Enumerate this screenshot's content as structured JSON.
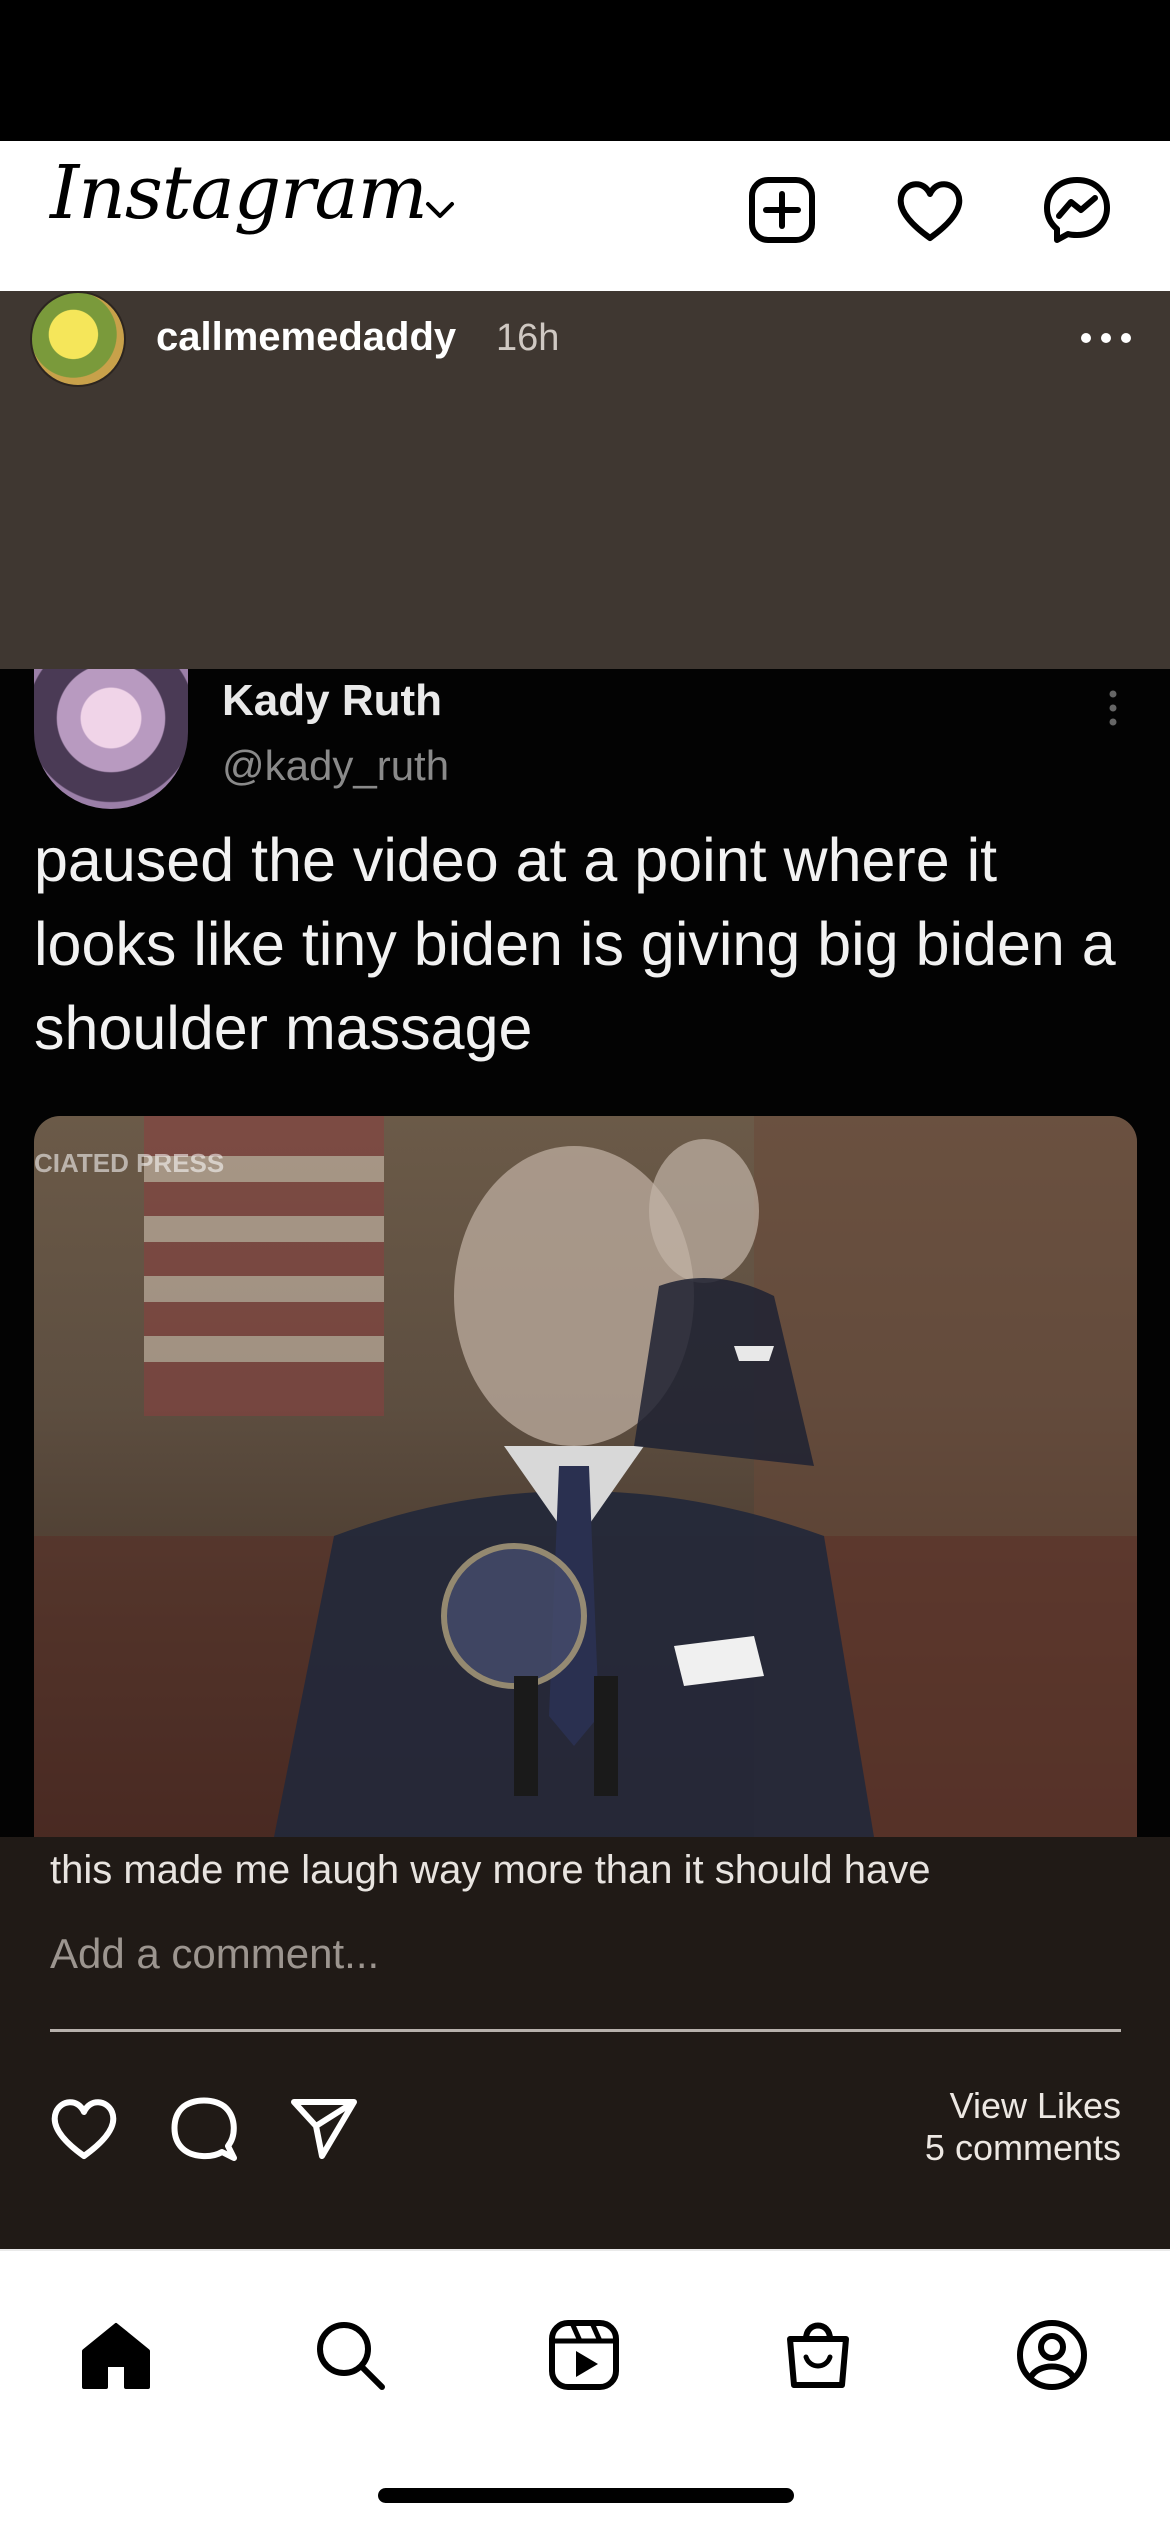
{
  "header": {
    "logo": "Instagram",
    "icons": [
      "chevron-down-icon",
      "new-post-icon",
      "heart-icon",
      "messenger-icon"
    ]
  },
  "post": {
    "username": "callmemedaddy",
    "time": "16h",
    "more_icon": "more-horizontal-icon"
  },
  "tweet": {
    "name": "Kady Ruth",
    "handle": "@kady_ruth",
    "text": "paused the video at a point where it looks like tiny biden is giving big biden a shoulder massage",
    "photo_watermark": "CIATED PRESS"
  },
  "comments": {
    "caption": "this made me laugh way more than it should have",
    "add_placeholder": "Add a comment...",
    "view_likes": "View Likes",
    "count": "5 comments"
  },
  "actions": [
    "like-icon",
    "comment-icon",
    "share-icon"
  ],
  "nav": [
    "home-icon",
    "search-icon",
    "reels-icon",
    "shop-icon",
    "profile-icon"
  ],
  "colors": {
    "header_bg": "#ffffff",
    "post_header_bg": "#3f3731",
    "comment_bg": "#201a16",
    "tweet_bg": "#030303"
  }
}
